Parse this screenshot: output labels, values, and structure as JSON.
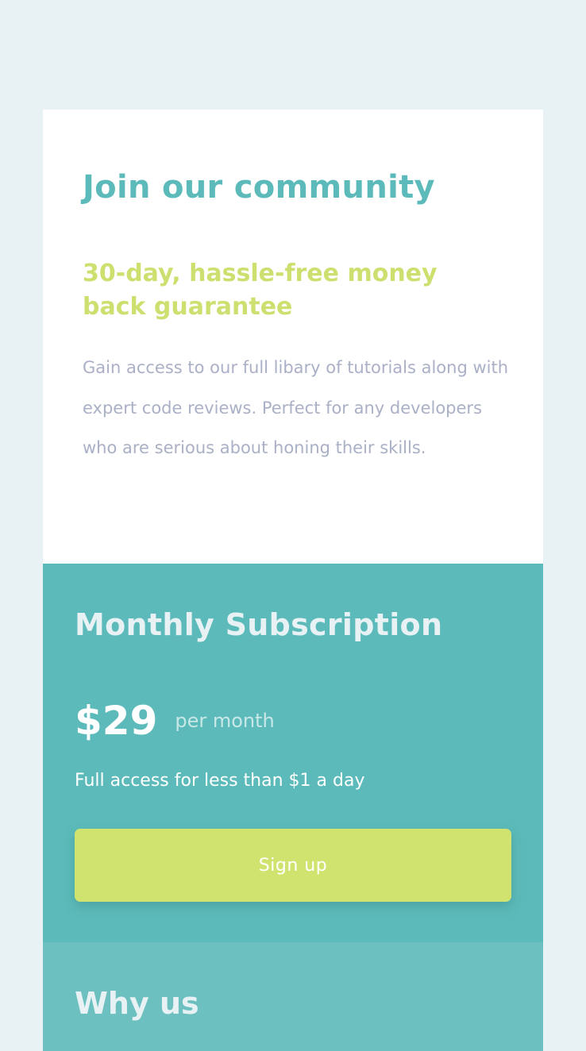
{
  "intro": {
    "title": "Join our community",
    "subtitle": "30-day, hassle-free money back guarantee",
    "description": "Gain access to our full libary of tutorials along with expert code reviews. Perfect for any developers who are serious about honing their skills."
  },
  "subscription": {
    "title": "Monthly Subscription",
    "price": "$29",
    "period": "per month",
    "tagline": "Full access for less than $1 a day",
    "button_label": "Sign up"
  },
  "why": {
    "title": "Why us"
  },
  "colors": {
    "background": "#e8f1f4",
    "accent_teal": "#5cbbba",
    "accent_lime": "#cde06f",
    "button": "#d1e36f",
    "why_bg": "#6cc1c0",
    "text_muted": "#aab0c6"
  }
}
